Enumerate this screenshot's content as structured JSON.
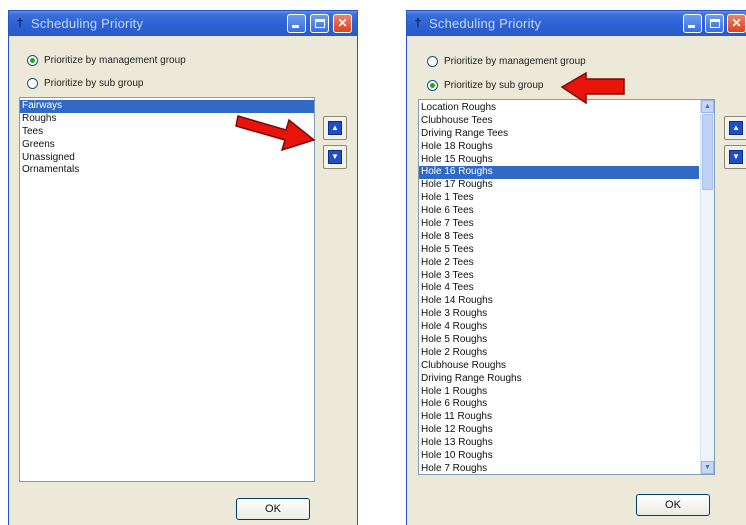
{
  "windows": [
    {
      "title": "Scheduling Priority",
      "radios": [
        {
          "label": "Prioritize by management group",
          "checked": true
        },
        {
          "label": "Prioritize by sub group",
          "checked": false
        }
      ],
      "list": {
        "selected_index": 0,
        "items": [
          "Fairways",
          "Roughs",
          "Tees",
          "Greens",
          "Unassigned",
          "Ornamentals"
        ]
      },
      "ok_label": "OK"
    },
    {
      "title": "Scheduling Priority",
      "radios": [
        {
          "label": "Prioritize by management group",
          "checked": false
        },
        {
          "label": "Prioritize by sub group",
          "checked": true
        }
      ],
      "list": {
        "selected_index": 5,
        "items": [
          "Location Roughs",
          "Clubhouse Tees",
          "Driving Range Tees",
          "Hole 18 Roughs",
          "Hole 15 Roughs",
          "Hole 16 Roughs",
          "Hole 17 Roughs",
          "Hole 1 Tees",
          "Hole 6 Tees",
          "Hole 7 Tees",
          "Hole 8 Tees",
          "Hole 5 Tees",
          "Hole 2 Tees",
          "Hole 3 Tees",
          "Hole 4 Tees",
          "Hole 14 Roughs",
          "Hole 3 Roughs",
          "Hole 4 Roughs",
          "Hole 5 Roughs",
          "Hole 2 Roughs",
          "Clubhouse Roughs",
          "Driving Range Roughs",
          "Hole 1 Roughs",
          "Hole 6 Roughs",
          "Hole 11 Roughs",
          "Hole 12 Roughs",
          "Hole 13 Roughs",
          "Hole 10 Roughs",
          "Hole 7 Roughs"
        ]
      },
      "ok_label": "OK"
    }
  ],
  "icons": {
    "app": "pin-icon",
    "move_up": "triangle-up-icon",
    "move_down": "triangle-down-icon",
    "annotation": "red-arrow-icon"
  },
  "colors": {
    "titlebar": "#2d62d4",
    "dialog_bg": "#ece9d8",
    "selection": "#316ac5",
    "annotation_arrow": "#e8140c"
  }
}
